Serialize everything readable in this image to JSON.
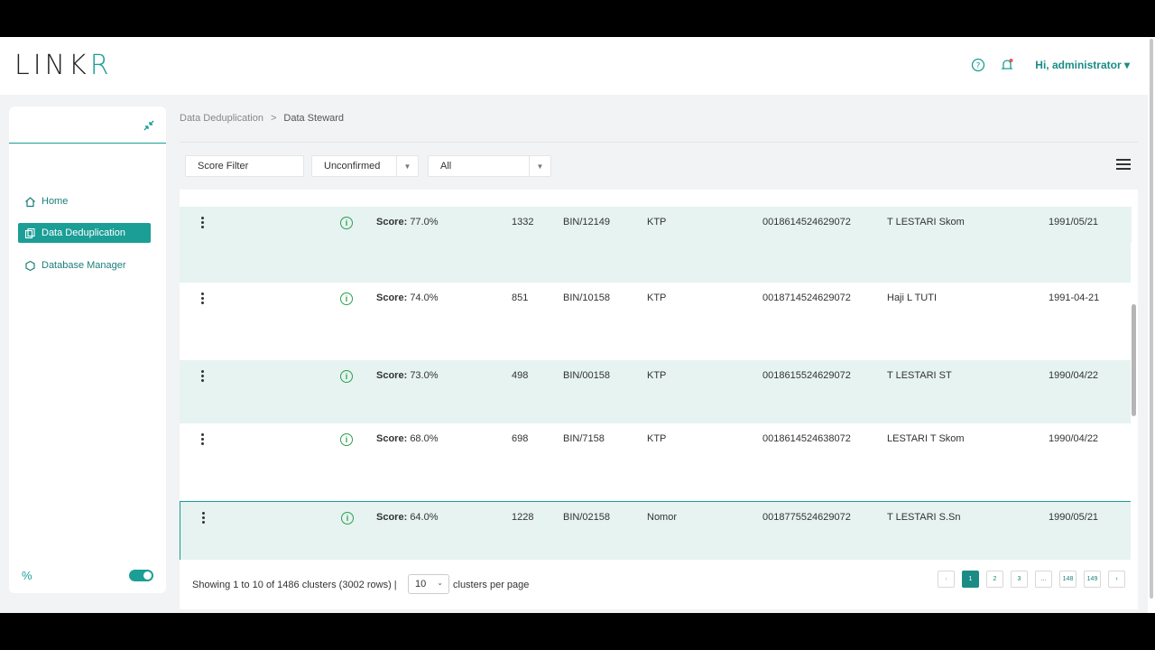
{
  "app": {
    "logo_main": "LINK",
    "logo_accent": "R",
    "user_greeting": "Hi, administrator"
  },
  "icons": {
    "help": "help-chat-icon",
    "notifications": "bell-icon",
    "collapse": "collapse-arrows-icon",
    "menu": "hamburger-menu-icon"
  },
  "sidebar": {
    "items": [
      {
        "label": "Home",
        "icon": "home-icon"
      },
      {
        "label": "Data Deduplication",
        "icon": "copy-icon"
      },
      {
        "label": "Database Manager",
        "icon": "database-icon"
      }
    ],
    "footer_symbol": "%",
    "theme_toggle_on": true
  },
  "breadcrumb": {
    "parent": "Data Deduplication",
    "separator": ">",
    "current": "Data Steward"
  },
  "filters": {
    "score_filter": "Score Filter",
    "status": "Unconfirmed",
    "scope": "All"
  },
  "rows": [
    {
      "score_label": "Score:",
      "score": "77.0%",
      "count": "1332",
      "bin": "BIN/12149",
      "doc": "KTP",
      "number": "0018614524629072",
      "name": "T LESTARI Skom",
      "date": "1991/05/21"
    },
    {
      "score_label": "Score:",
      "score": "74.0%",
      "count": "851",
      "bin": "BIN/10158",
      "doc": "KTP",
      "number": "0018714524629072",
      "name": "Haji L TUTI",
      "date": "1991-04-21"
    },
    {
      "score_label": "Score:",
      "score": "73.0%",
      "count": "498",
      "bin": "BIN/00158",
      "doc": "KTP",
      "number": "0018615524629072",
      "name": "T LESTARI ST",
      "date": "1990/04/22"
    },
    {
      "score_label": "Score:",
      "score": "68.0%",
      "count": "698",
      "bin": "BIN/7158",
      "doc": "KTP",
      "number": "0018614524638072",
      "name": "LESTARI T Skom",
      "date": "1990/04/22"
    },
    {
      "score_label": "Score:",
      "score": "64.0%",
      "count": "1228",
      "bin": "BIN/02158",
      "doc": "Nomor",
      "number": "0018775524629072",
      "name": "T LESTARI S.Sn",
      "date": "1990/05/21"
    }
  ],
  "footer": {
    "showing": "Showing 1 to 10 of 1486 clusters (3002 rows) |",
    "per_page_value": "10",
    "per_page_label": "clusters per page",
    "pages": [
      "‹",
      "1",
      "2",
      "3",
      "...",
      "148",
      "149",
      "›"
    ],
    "active_page": "1"
  }
}
